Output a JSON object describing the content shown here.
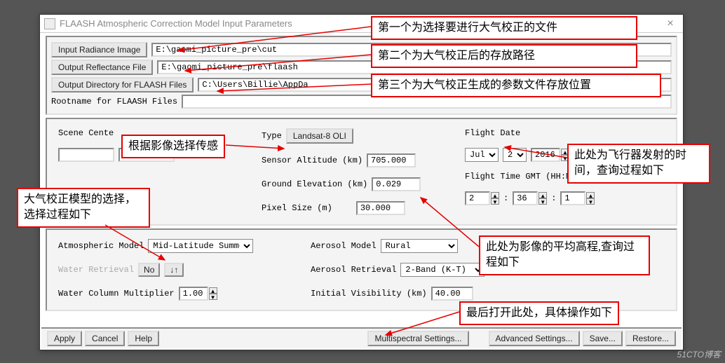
{
  "title": "FLAASH Atmospheric Correction Model Input Parameters",
  "files": {
    "input_radiance_btn": "Input Radiance Image",
    "input_radiance_val": "E:\\gaomi_picture_pre\\cut",
    "output_refl_btn": "Output Reflectance File",
    "output_refl_val": "E:\\gaomi_picture_pre\\flaash",
    "output_dir_btn": "Output Directory for FLAASH Files",
    "output_dir_val": "C:\\Users\\Billie\\AppDa",
    "rootname_lbl": "Rootname for FLAASH Files",
    "rootname_val": ""
  },
  "scene": {
    "center_lbl": "Scene Cente",
    "sensor_type_lbl": "Type",
    "sensor_type_val": "Landsat-8 OLI",
    "sensor_alt_lbl": "Sensor Altitude (km)",
    "sensor_alt_val": "705.000",
    "ground_elev_lbl": "Ground Elevation (km)",
    "ground_elev_val": "0.029",
    "pixel_size_lbl": "Pixel Size (m)",
    "pixel_size_val": "30.000",
    "flight_date_lbl": "Flight Date",
    "flight_month": "Jul",
    "flight_day": "2",
    "flight_year": "2016",
    "flight_time_lbl": "Flight Time GMT (HH:MM:SS)",
    "ft_h": "2",
    "ft_m": "36",
    "ft_s": "1"
  },
  "atmos": {
    "model_lbl": "Atmospheric Model",
    "model_val": "Mid-Latitude Summer",
    "water_ret_lbl": "Water Retrieval",
    "water_ret_val": "No",
    "water_col_lbl": "Water Column Multiplier",
    "water_col_val": "1.00",
    "aero_model_lbl": "Aerosol Model",
    "aero_model_val": "Rural",
    "aero_ret_lbl": "Aerosol Retrieval",
    "aero_ret_val": "2-Band (K-T)",
    "init_vis_lbl": "Initial Visibility (km)",
    "init_vis_val": "40.00"
  },
  "buttons": {
    "apply": "Apply",
    "cancel": "Cancel",
    "help": "Help",
    "multi": "Multispectral Settings...",
    "adv": "Advanced Settings...",
    "save": "Save...",
    "restore": "Restore..."
  },
  "annots": {
    "a1": "第一个为选择要进行大气校正的文件",
    "a2": "第二个为大气校正后的存放路径",
    "a3": "第三个为大气校正生成的参数文件存放位置",
    "a4": "根据影像选择传感",
    "a5": "大气校正模型的选择，选择过程如下",
    "a6": "此处为飞行器发射的时间，查询过程如下",
    "a7": "此处为影像的平均高程,查询过程如下",
    "a8": "最后打开此处，具体操作如下"
  },
  "watermark": "51CTO博客"
}
